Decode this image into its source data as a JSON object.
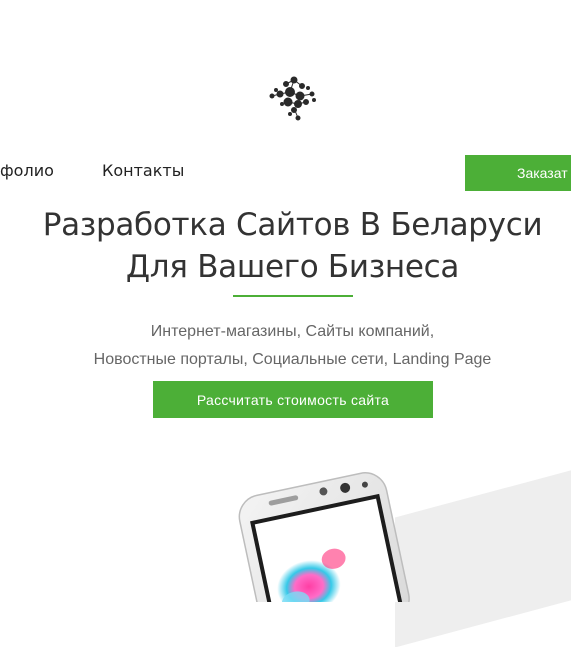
{
  "nav": {
    "portfolio": "фолио",
    "contacts": "Контакты",
    "order_button": "Заказат"
  },
  "hero": {
    "title_line1": "Разработка Сайтов В Беларуси",
    "title_line2": "Для Вашего Бизнеса",
    "subtitle_line1": "Интернет-магазины, Сайты компаний,",
    "subtitle_line2": "Новостные порталы, Социальные сети, Landing Page",
    "cta_button": "Рассчитать стоимость сайта"
  },
  "colors": {
    "accent": "#4caf37",
    "heading": "#333333",
    "subtitle": "#666666"
  },
  "icons": {
    "logo": "molecule-network-logo"
  }
}
